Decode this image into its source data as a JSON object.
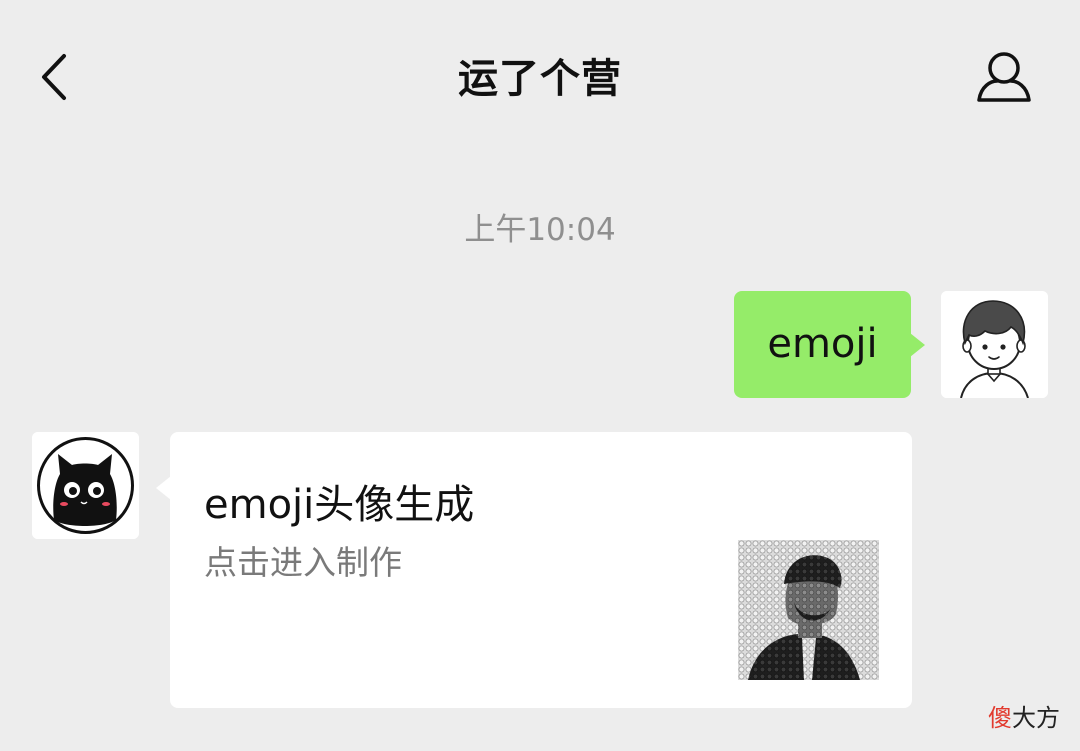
{
  "header": {
    "title": "运了个营",
    "back_icon": "chevron-left-icon",
    "profile_icon": "user-icon"
  },
  "chat": {
    "timestamp": "上午10:04",
    "outgoing": {
      "text": "emoji",
      "bubble_color": "#95ec69",
      "avatar": "cartoon-boy-avatar"
    },
    "incoming_card": {
      "avatar": "black-cat-avatar",
      "title": "emoji头像生成",
      "subtitle": "点击进入制作",
      "thumbnail": "emoji-mosaic-portrait"
    }
  },
  "watermark": {
    "first": "傻",
    "rest": "大方"
  },
  "colors": {
    "background": "#ededed",
    "bubble_out": "#95ec69",
    "card": "#ffffff",
    "text_secondary": "#7a7a7a",
    "timestamp": "#8f8f8f",
    "watermark_accent": "#e23a2e"
  }
}
